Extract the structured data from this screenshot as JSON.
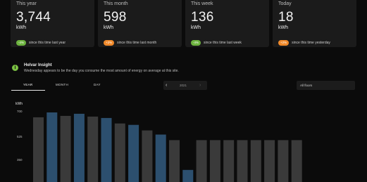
{
  "stats": [
    {
      "title": "This year",
      "value": "3,744",
      "unit": "kWh",
      "badge": "-4%",
      "badge_color": "green",
      "note": "since this time last year"
    },
    {
      "title": "This month",
      "value": "598",
      "unit": "kWh",
      "badge": "+2%",
      "badge_color": "orange",
      "note": "since this time last month"
    },
    {
      "title": "This week",
      "value": "136",
      "unit": "kWh",
      "badge": "-4%",
      "badge_color": "green",
      "note": "since this time last week"
    },
    {
      "title": "Today",
      "value": "18",
      "unit": "kWh",
      "badge": "+2%",
      "badge_color": "orange",
      "note": "since this time yesterday"
    }
  ],
  "insight": {
    "icon": "info-icon",
    "title": "Helvar Insight",
    "text": "Wednesday appears to be the day you consume the most amount of energy on average at this site."
  },
  "tabs": [
    {
      "label": "YEAR",
      "active": true
    },
    {
      "label": "MONTH",
      "active": false
    },
    {
      "label": "DAY",
      "active": false
    }
  ],
  "year_nav": {
    "prev_icon": "chevron-left-icon",
    "year": "2021",
    "next_icon": "chevron-right-icon"
  },
  "floor_select": {
    "value": "All floors"
  },
  "colors": {
    "accent_green": "#6db33f",
    "accent_orange": "#f08a2b",
    "bar_grey": "#3a3a3a",
    "bar_blue": "#2c4f6e"
  },
  "chart_data": {
    "type": "bar",
    "ylabel": "kWh",
    "y_ticks": [
      "700",
      "525",
      "350"
    ],
    "ylim": [
      0,
      700
    ],
    "series": [
      {
        "values": [
          655,
          690,
          665,
          680,
          660,
          650,
          610,
          600,
          560,
          530,
          490,
          275,
          490,
          490,
          490,
          490,
          490,
          490,
          490,
          490
        ],
        "highlight": [
          false,
          true,
          false,
          true,
          false,
          true,
          false,
          true,
          false,
          true,
          false,
          true,
          false,
          false,
          false,
          false,
          false,
          false,
          false,
          false
        ]
      }
    ]
  }
}
